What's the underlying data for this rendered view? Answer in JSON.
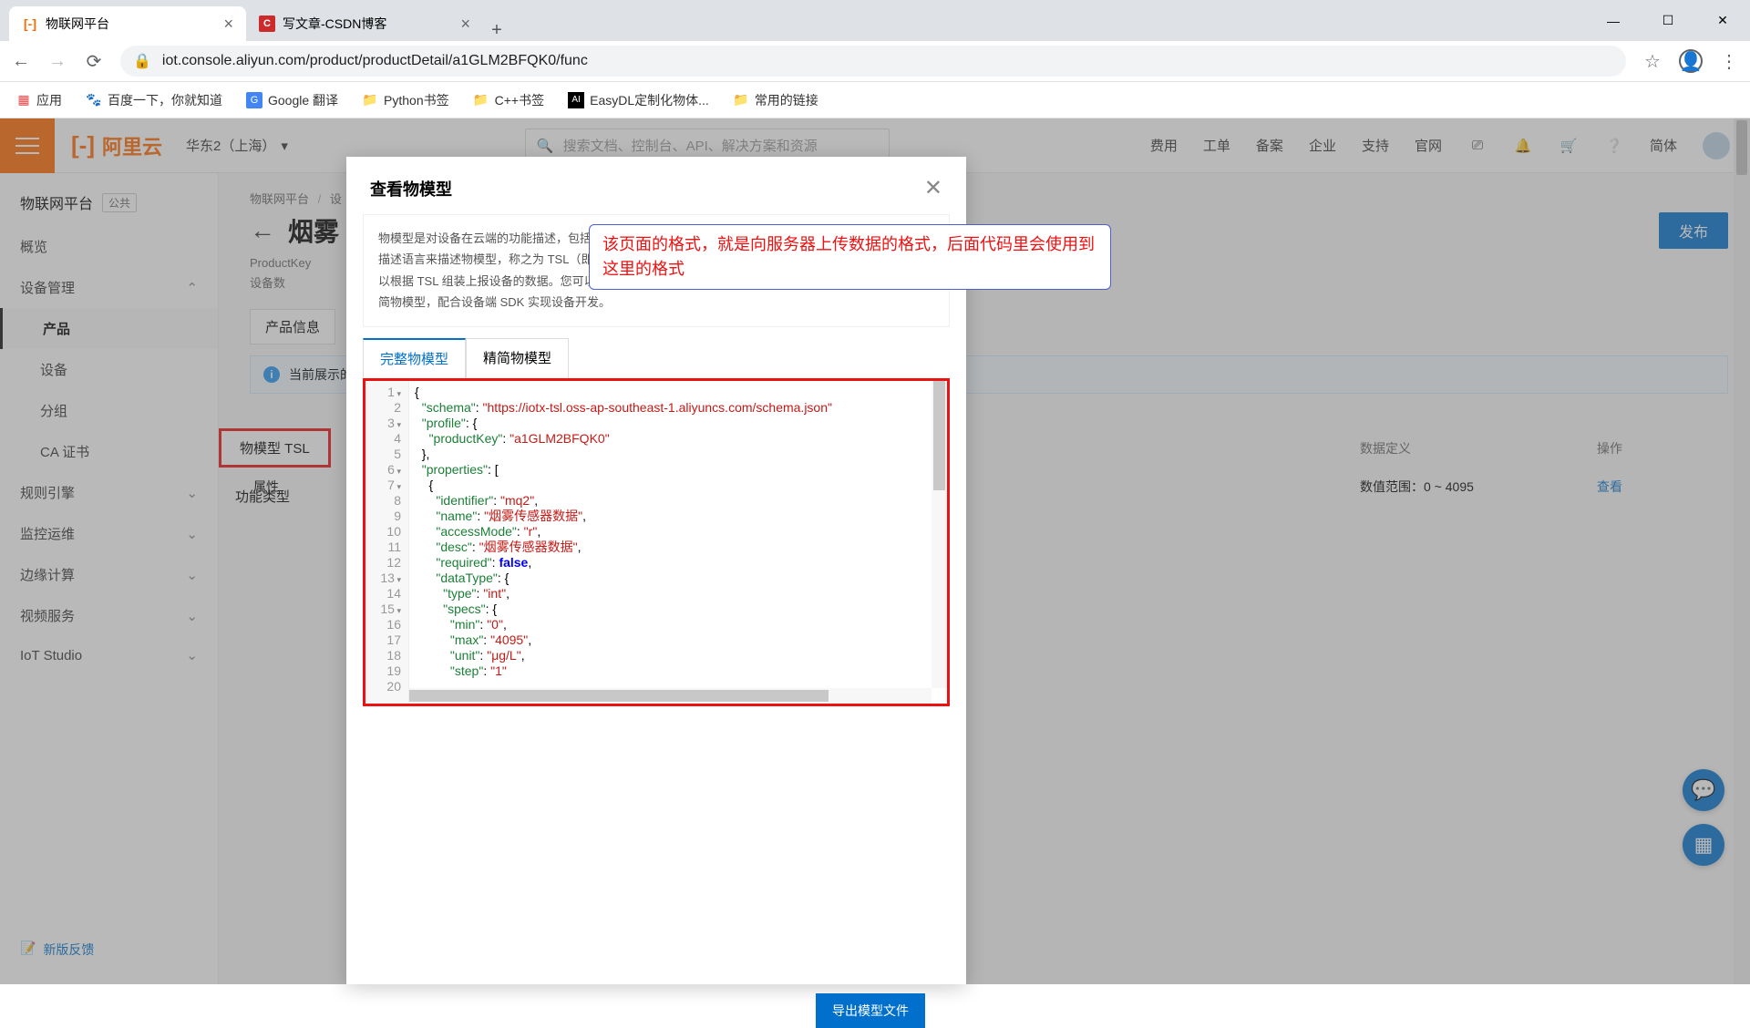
{
  "browser": {
    "tabs": [
      {
        "title": "物联网平台",
        "favicon_color": "#ff6a00"
      },
      {
        "title": "写文章-CSDN博客",
        "favicon_color": "#cc2b2b"
      }
    ],
    "new_tab": "+",
    "url": "iot.console.aliyun.com/product/productDetail/a1GLM2BFQK0/func"
  },
  "bookmarks": {
    "apps": "应用",
    "items": [
      "百度一下，你就知道",
      "Google 翻译",
      "Python书签",
      "C++书签",
      "EasyDL定制化物体...",
      "常用的链接"
    ]
  },
  "topbar": {
    "logo_text": "阿里云",
    "region": "华东2（上海）",
    "search_placeholder": "搜索文档、控制台、API、解决方案和资源",
    "links": [
      "费用",
      "工单",
      "备案",
      "企业",
      "支持",
      "官网"
    ],
    "lang": "简体"
  },
  "sidebar": {
    "heading": "物联网平台",
    "badge": "公共",
    "items": [
      "概览",
      "设备管理",
      "产品",
      "设备",
      "分组",
      "CA 证书",
      "规则引擎",
      "监控运维",
      "边缘计算",
      "视频服务",
      "IoT Studio"
    ],
    "feedback": "新版反馈"
  },
  "content": {
    "crumb1": "物联网平台",
    "crumb2": "设",
    "title_partial": "烟雾",
    "pk_label": "ProductKey",
    "count_label": "设备数",
    "publish": "发布",
    "utabs": [
      "产品信息",
      "物模型 TSL",
      "功能类型"
    ],
    "banner": "当前展示的",
    "col_label": "属性",
    "row_c2": "数值范围：0 ~ 4095",
    "row_c3": "查看",
    "right_cols": [
      "数据定义",
      "操作"
    ]
  },
  "modal": {
    "title": "查看物模型",
    "desc_l1": "物模型是对设备在云端的功能描述，包括设备的属性、服务和事件。物联网平台通过定义一种物的",
    "desc_l2": "描述语言来描述物模型，称之为 TSL（即 Thing Specification Language），采用 JSON 格式，您可",
    "desc_l3": "以根据 TSL 组装上报设备的数据。您可以导出完整物模型，用于云端应用开发；您也可以只导出精",
    "desc_l4": "简物模型，配合设备端 SDK 实现设备开发。",
    "tabs": [
      "完整物模型",
      "精简物模型"
    ],
    "export": "导出模型文件"
  },
  "annotation": "该页面的格式，就是向服务器上传数据的格式，后面代码里会使用到这里的格式",
  "code": {
    "schema": "https://iotx-tsl.oss-ap-southeast-1.aliyuncs.com/schema.json",
    "productKey": "a1GLM2BFQK0",
    "identifier": "mq2",
    "name": "烟雾传感器数据",
    "accessMode": "r",
    "desc": "烟雾传感器数据",
    "required": "false",
    "type": "int",
    "min": "0",
    "max": "4095",
    "unit": "μg/L",
    "step": "1"
  }
}
